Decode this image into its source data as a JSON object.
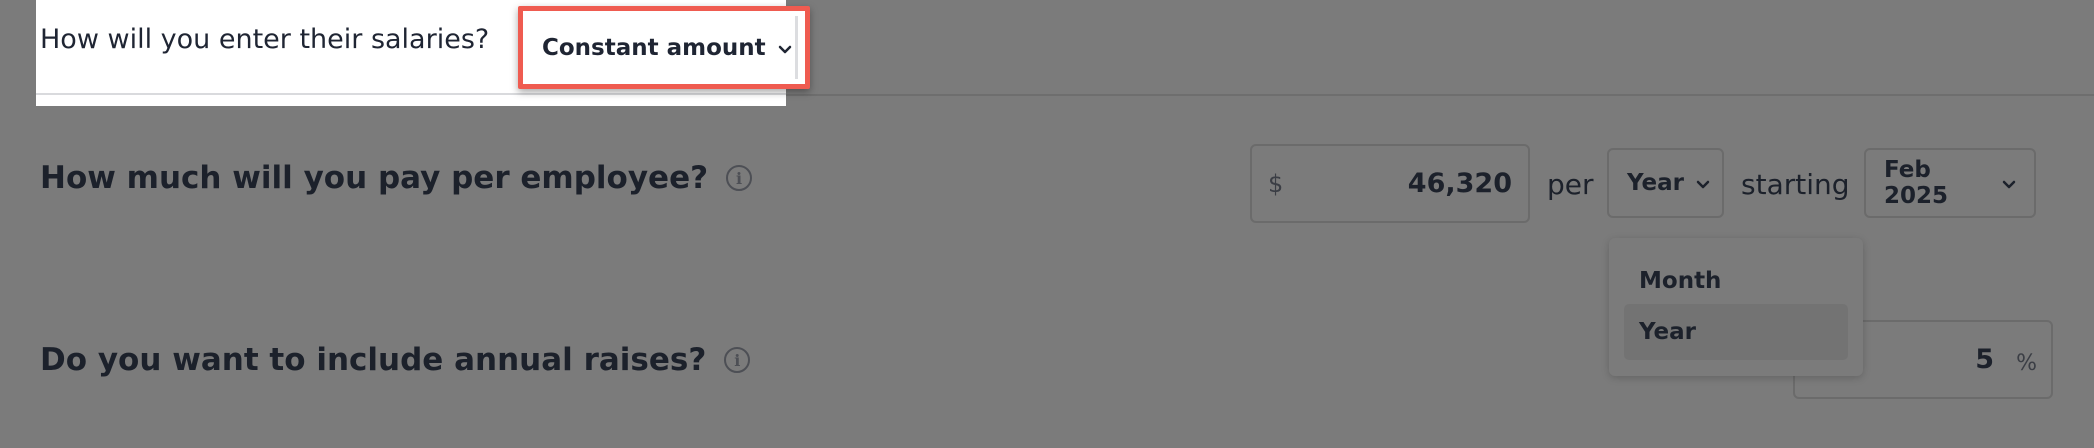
{
  "salary_method": {
    "question": "How will you enter their salaries?",
    "selected": "Constant amount"
  },
  "pay_per_employee": {
    "question": "How much will you pay per employee?",
    "currency_symbol": "$",
    "amount": "46,320",
    "per_label": "per",
    "period": "Year",
    "starting_label": "starting",
    "start_date": "Feb 2025"
  },
  "period_menu": {
    "options": [
      "Month",
      "Year"
    ],
    "selected_index": 1
  },
  "annual_raises": {
    "question": "Do you want to include annual raises?",
    "value": "5",
    "unit": "%"
  },
  "colors": {
    "highlight": "#ef5b50",
    "overlay": "#7b7b7b"
  },
  "icons": {
    "info": "info-icon",
    "chevron": "chevron-down-icon"
  }
}
